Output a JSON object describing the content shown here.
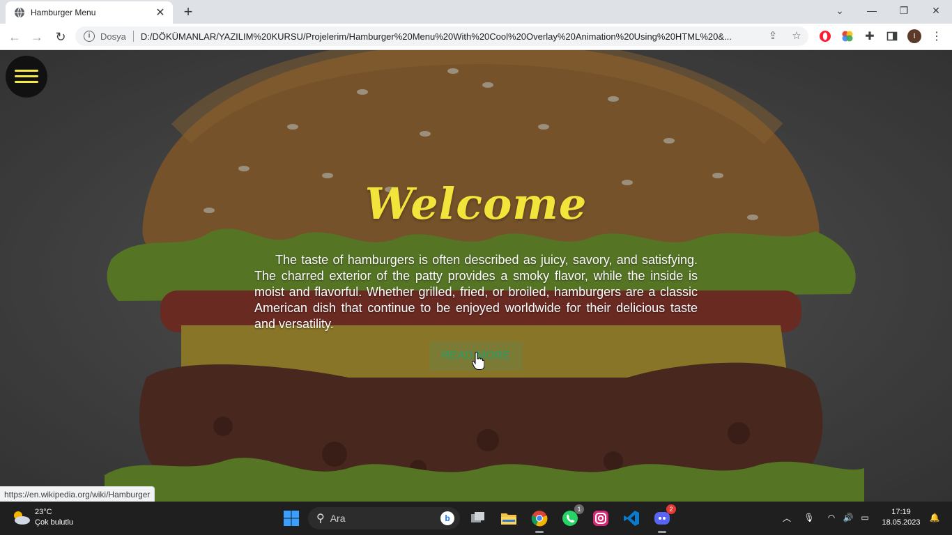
{
  "browser": {
    "tab_title": "Hamburger Menu",
    "new_tab": "+",
    "scheme_label": "Dosya",
    "url": "D:/DÖKÜMANLAR/YAZILIM%20KURSU/Projelerim/Hamburger%20Menu%20With%20Cool%20Overlay%20Animation%20Using%20HTML%20&...",
    "profile_initial": "I",
    "status_url": "https://en.wikipedia.org/wiki/Hamburger"
  },
  "page": {
    "heading": "Welcome",
    "description": "The taste of hamburgers is often described as juicy, savory, and satisfying. The charred exterior of the patty provides a smoky flavor, while the inside is moist and flavorful. Whether grilled, fried, or broiled, hamburgers are a classic American dish that continue to be enjoyed worldwide for their delicious taste and versatility.",
    "button_label": "READ MORE",
    "colors": {
      "heading": "#f2e43b",
      "button_text": "#23a06a",
      "menu_bars": "#f4e842"
    }
  },
  "taskbar": {
    "weather_temp": "23°C",
    "weather_desc": "Çok bulutlu",
    "search_placeholder": "Ara",
    "whatsapp_badge": "1",
    "discord_badge": "2",
    "time": "17:19",
    "date": "18.05.2023"
  }
}
